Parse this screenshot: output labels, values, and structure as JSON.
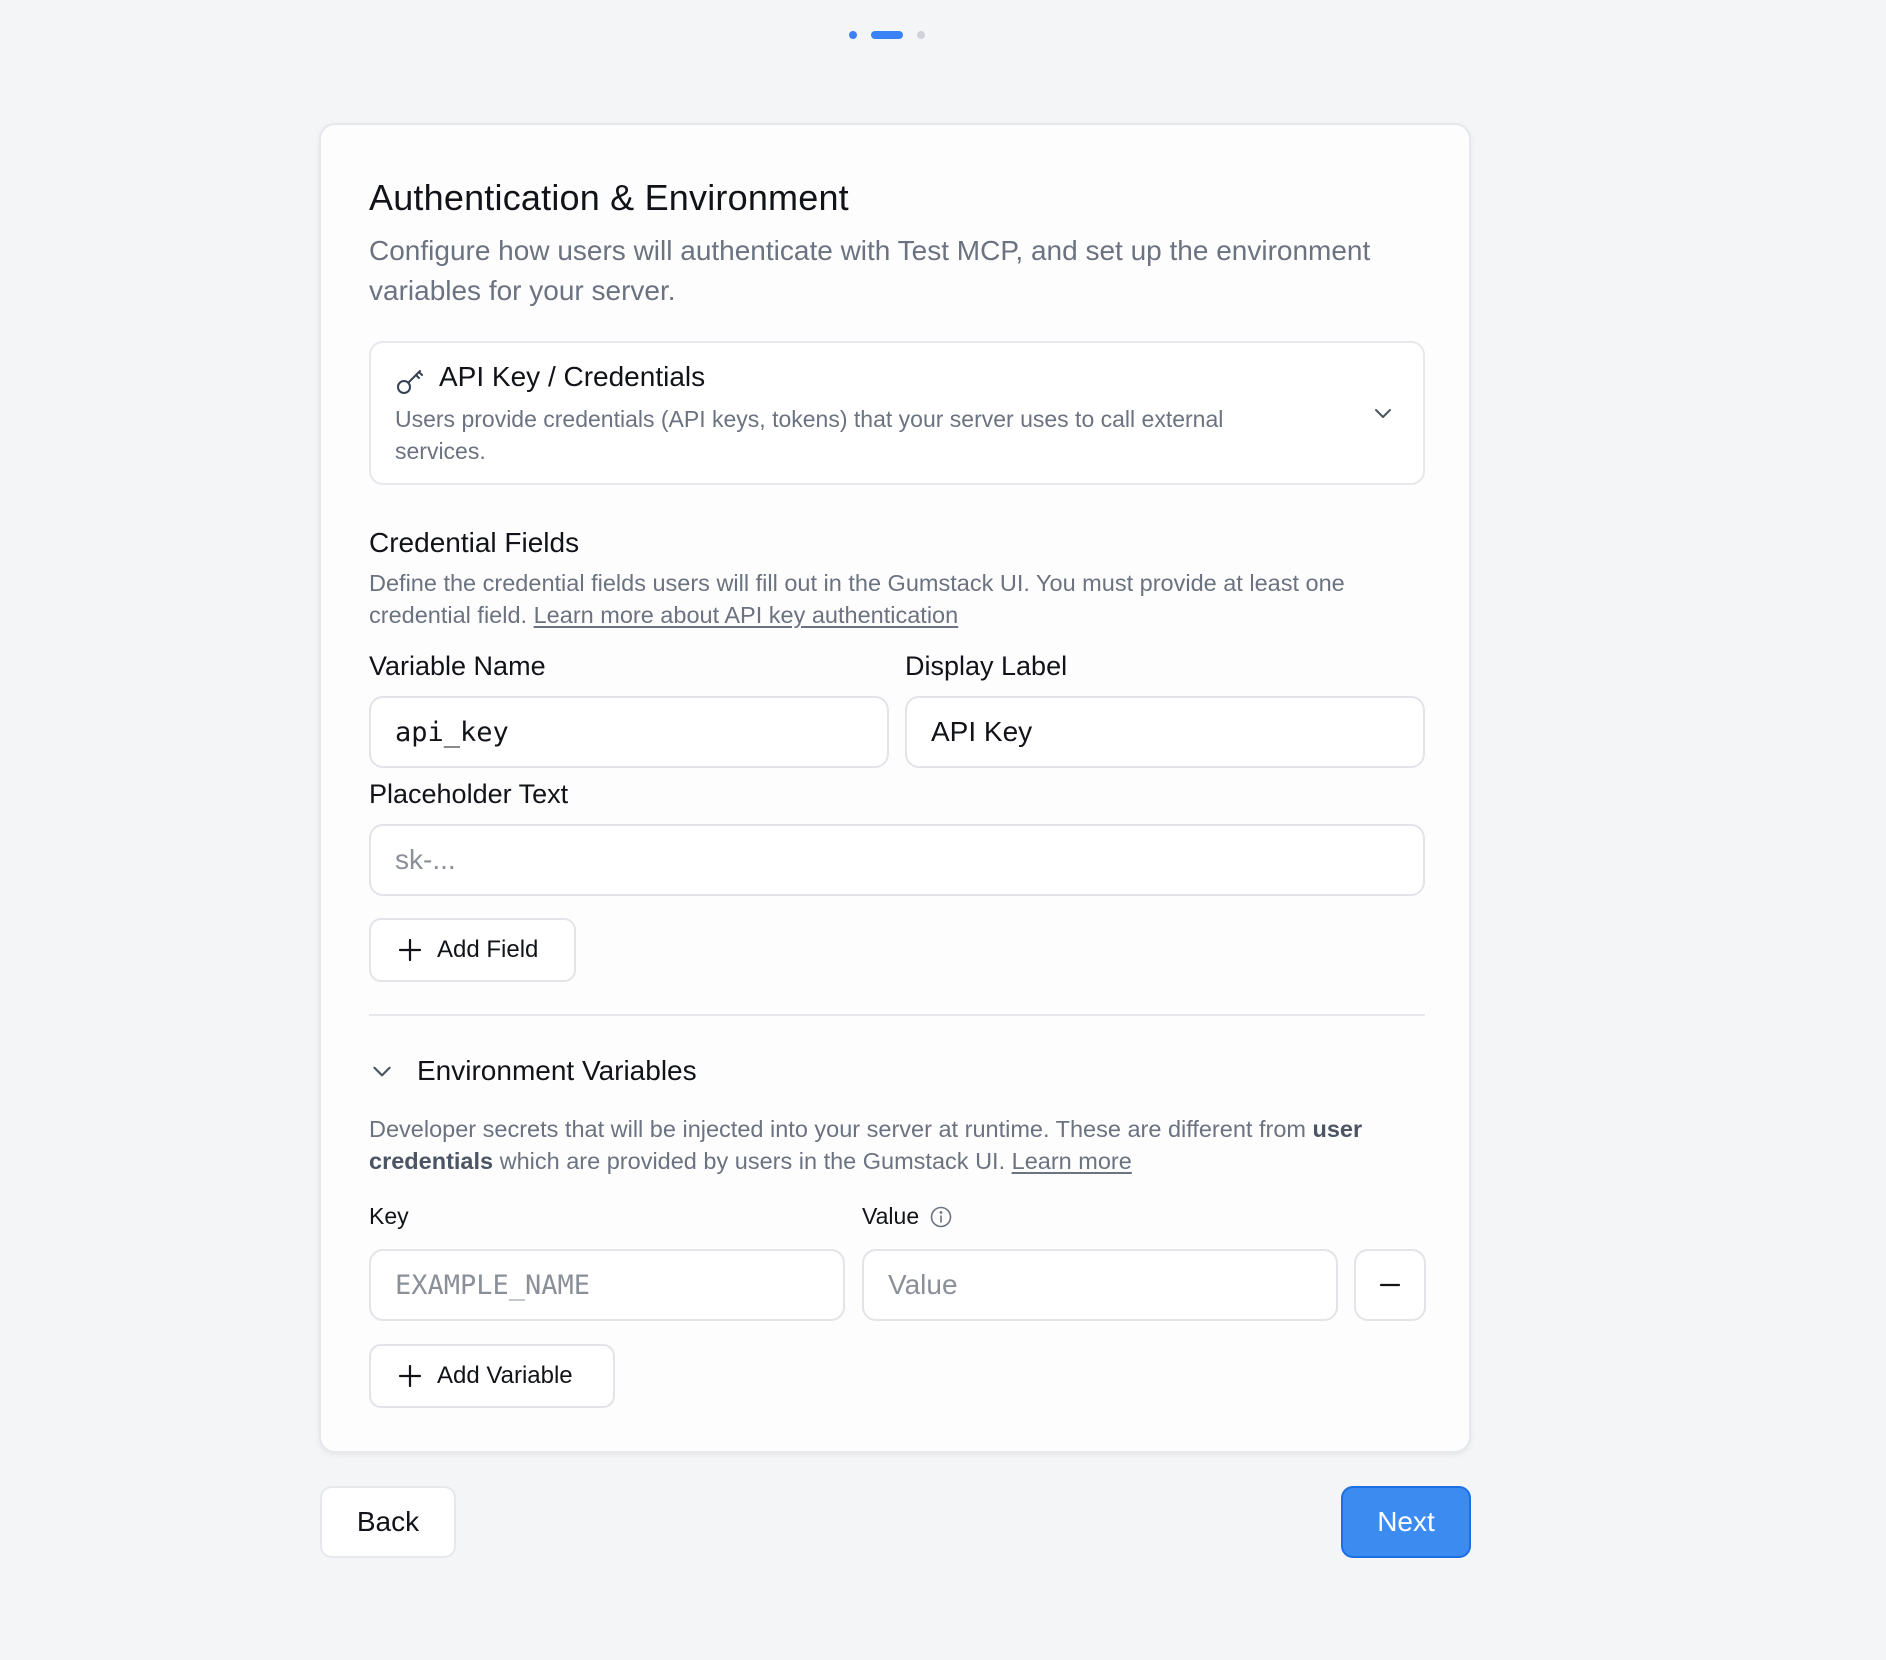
{
  "stepper": {
    "current_step": 2,
    "total_steps": 3
  },
  "header": {
    "title": "Authentication & Environment",
    "subtitle": "Configure how users will authenticate with Test MCP, and set up the environment variables for your server."
  },
  "auth_method": {
    "icon": "key-icon",
    "title": "API Key / Credentials",
    "description": "Users provide credentials (API keys, tokens) that your server uses to call external services."
  },
  "credential_fields": {
    "title": "Credential Fields",
    "description": "Define the credential fields users will fill out in the Gumstack UI. You must provide at least one credential field.",
    "link": "Learn more about API key authentication",
    "variable_name_label": "Variable Name",
    "variable_name_value": "api_key",
    "display_label_label": "Display Label",
    "display_label_value": "API Key",
    "placeholder_label": "Placeholder Text",
    "placeholder_placeholder": "sk-...",
    "add_field_label": "Add Field"
  },
  "env_vars": {
    "title": "Environment Variables",
    "description_part1": "Developer secrets that will be injected into your server at runtime. These are different from",
    "description_bold": "user credentials",
    "description_part2": "which are provided by users in the Gumstack UI.",
    "link": "Learn more",
    "key_label": "Key",
    "value_label": "Value",
    "key_placeholder": "EXAMPLE_NAME",
    "value_placeholder": "Value",
    "add_variable_label": "Add Variable"
  },
  "footer": {
    "back_label": "Back",
    "next_label": "Next"
  },
  "colors": {
    "accent": "#3b82f6",
    "muted_text": "#6b7280",
    "border": "#e6e8ec"
  }
}
